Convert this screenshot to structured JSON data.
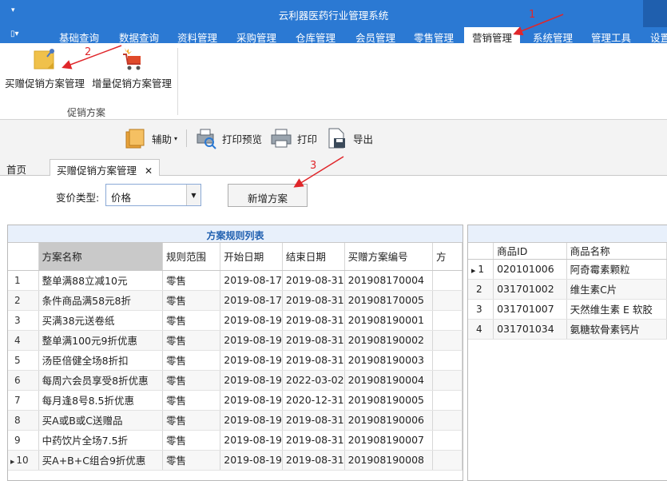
{
  "titlebar": {
    "quick_access": "▾",
    "title": "云利器医药行业管理系统"
  },
  "menu": {
    "app_button": "▯▾",
    "tabs": [
      {
        "label": "基础查询"
      },
      {
        "label": "数据查询"
      },
      {
        "label": "资料管理"
      },
      {
        "label": "采购管理"
      },
      {
        "label": "仓库管理"
      },
      {
        "label": "会员管理"
      },
      {
        "label": "零售管理"
      },
      {
        "label": "营销管理",
        "active": true
      },
      {
        "label": "系统管理"
      },
      {
        "label": "管理工具"
      },
      {
        "label": "设置"
      }
    ]
  },
  "ribbon": {
    "buttons": [
      {
        "label": "买赠促销方案管理",
        "icon": "sticky-note-pin-icon"
      },
      {
        "label": "增量促销方案管理",
        "icon": "shopping-cart-icon"
      }
    ],
    "group_label": "促销方案"
  },
  "toolbar": {
    "assist": "辅助",
    "print_preview": "打印预览",
    "print": "打印",
    "export": "导出"
  },
  "doc_tabs": [
    {
      "label": "首页"
    },
    {
      "label": "买赠促销方案管理",
      "active": true,
      "close": "✕"
    }
  ],
  "filter": {
    "label": "变价类型:",
    "value": "价格",
    "new_button": "新增方案"
  },
  "grid": {
    "title": "方案规则列表",
    "columns": [
      "方案名称",
      "规则范围",
      "开始日期",
      "结束日期",
      "买赠方案编号",
      "方"
    ],
    "rows": [
      {
        "no": "1",
        "name": "整单满88立减10元",
        "scope": "零售",
        "start": "2019-08-17",
        "end": "2019-08-31",
        "code": "201908170004"
      },
      {
        "no": "2",
        "name": "条件商品满58元8折",
        "scope": "零售",
        "start": "2019-08-17",
        "end": "2019-08-31",
        "code": "201908170005"
      },
      {
        "no": "3",
        "name": "买满38元送卷纸",
        "scope": "零售",
        "start": "2019-08-19",
        "end": "2019-08-31",
        "code": "201908190001"
      },
      {
        "no": "4",
        "name": "整单满100元9折优惠",
        "scope": "零售",
        "start": "2019-08-19",
        "end": "2019-08-31",
        "code": "201908190002"
      },
      {
        "no": "5",
        "name": "汤臣倍健全场8折扣",
        "scope": "零售",
        "start": "2019-08-19",
        "end": "2019-08-31",
        "code": "201908190003"
      },
      {
        "no": "6",
        "name": "每周六会员享受8折优惠",
        "scope": "零售",
        "start": "2019-08-19",
        "end": "2022-03-02",
        "code": "201908190004"
      },
      {
        "no": "7",
        "name": "每月逢8号8.5折优惠",
        "scope": "零售",
        "start": "2019-08-19",
        "end": "2020-12-31",
        "code": "201908190005"
      },
      {
        "no": "8",
        "name": "买A或B或C送赠品",
        "scope": "零售",
        "start": "2019-08-19",
        "end": "2019-08-31",
        "code": "201908190006"
      },
      {
        "no": "9",
        "name": "中药饮片全场7.5折",
        "scope": "零售",
        "start": "2019-08-19",
        "end": "2019-08-31",
        "code": "201908190007"
      },
      {
        "no": "10",
        "name": "买A+B+C组合9折优惠",
        "scope": "零售",
        "start": "2019-08-19",
        "end": "2019-08-31",
        "code": "201908190008",
        "current": true
      }
    ]
  },
  "side_grid": {
    "columns": [
      "商品ID",
      "商品名称"
    ],
    "rows": [
      {
        "no": "1",
        "id": "020101006",
        "name": "阿奇霉素颗粒",
        "current": true
      },
      {
        "no": "2",
        "id": "031701002",
        "name": "维生素C片"
      },
      {
        "no": "3",
        "id": "031701007",
        "name": "天然维生素 E 软胶"
      },
      {
        "no": "4",
        "id": "031701034",
        "name": "氨糖软骨素钙片"
      }
    ]
  },
  "annotations": {
    "a1": "1",
    "a2": "2",
    "a3": "3"
  },
  "colors": {
    "accent": "#2b79d3",
    "annotation": "#e0262a"
  }
}
